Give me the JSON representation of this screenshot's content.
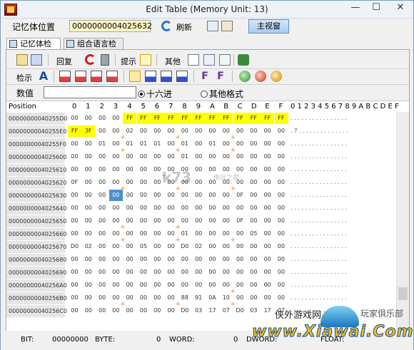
{
  "window": {
    "title": "Edit Table (Memory Unit: 13)",
    "controls": {
      "minimize": "—",
      "maximize": "☐",
      "close": "✕"
    }
  },
  "addressbar": {
    "label": "记忆体位置",
    "address": "0000000004025632",
    "refresh": "刷新",
    "main_view": "主视窗"
  },
  "tabs": [
    {
      "label": "记忆体检示"
    },
    {
      "label": "组合语言检示"
    }
  ],
  "toolbar1": {
    "revert": "回复",
    "hint": "提示",
    "other": "其他"
  },
  "toolbar2": {
    "display": "检示"
  },
  "valuebar": {
    "label": "数值",
    "radio_hex": "十六进",
    "radio_other": "其他格式"
  },
  "grid": {
    "position_header": "Position",
    "hex_headers": [
      "0",
      "1",
      "2",
      "3",
      "4",
      "5",
      "6",
      "7",
      "8",
      "9",
      "A",
      "B",
      "C",
      "D",
      "E",
      "F"
    ],
    "ascii_header": "0 1 2 3 4 5 6 7 8 9 A B C D E F",
    "rows": [
      {
        "addr": "00000000040255D0",
        "cells": [
          "00",
          "00",
          "00",
          "00",
          "FF",
          "FF",
          "FF",
          "FF",
          "FF",
          "FF",
          "FF",
          "FF",
          "FF",
          "FF",
          "FF",
          "FF"
        ],
        "ascii": ". . . . . . . . . . . . . . . ."
      },
      {
        "addr": "00000000040255E0",
        "cells": [
          "FF",
          "3F",
          "00",
          "00",
          "02",
          "00",
          "00",
          "00",
          "00",
          "00",
          "00",
          "00",
          "00",
          "00",
          "00",
          "00"
        ],
        "ascii": ". ? . . . . . . . . . . . . . ."
      },
      {
        "addr": "00000000040255F0",
        "cells": [
          "00",
          "00",
          "01",
          "00",
          "01",
          "01",
          "01",
          "00",
          "01",
          "00",
          "01",
          "00",
          "00",
          "00",
          "00",
          "00"
        ],
        "ascii": ". . . . . . . . . . . . . . . ."
      },
      {
        "addr": "0000000004025600",
        "cells": [
          "00",
          "00",
          "00",
          "00",
          "00",
          "00",
          "00",
          "00",
          "01",
          "00",
          "00",
          "00",
          "00",
          "00",
          "00",
          "00"
        ],
        "ascii": ". . . . . . . . . . . . . . . ."
      },
      {
        "addr": "0000000004025610",
        "cells": [
          "00",
          "00",
          "00",
          "00",
          "00",
          "00",
          "00",
          "00",
          "00",
          "00",
          "00",
          "00",
          "00",
          "00",
          "00",
          "00"
        ],
        "ascii": ". . . . . . . . . . . . . . . ."
      },
      {
        "addr": "0000000004025620",
        "cells": [
          "0F",
          "00",
          "00",
          "00",
          "00",
          "00",
          "00",
          "00",
          "00",
          "00",
          "00",
          "00",
          "00",
          "00",
          "00",
          "00"
        ],
        "ascii": ". . . . . . . . . . . . . . . ."
      },
      {
        "addr": "0000000004025630",
        "cells": [
          "00",
          "00",
          "00",
          "00",
          "00",
          "00",
          "00",
          "00",
          "00",
          "00",
          "00",
          "00",
          "0F",
          "00",
          "00",
          "00"
        ],
        "ascii": ". . . . . . . . . . . . . . . ."
      },
      {
        "addr": "0000000004025640",
        "cells": [
          "00",
          "00",
          "00",
          "00",
          "00",
          "00",
          "00",
          "00",
          "00",
          "00",
          "00",
          "00",
          "00",
          "00",
          "00",
          "00"
        ],
        "ascii": ". . . . . . . . . . . . . . . ."
      },
      {
        "addr": "0000000004025650",
        "cells": [
          "00",
          "00",
          "00",
          "00",
          "00",
          "00",
          "00",
          "00",
          "00",
          "00",
          "00",
          "00",
          "0F",
          "00",
          "00",
          "00"
        ],
        "ascii": ". . . . . . . . . . . . . . . ."
      },
      {
        "addr": "0000000004025660",
        "cells": [
          "00",
          "00",
          "00",
          "00",
          "00",
          "00",
          "00",
          "00",
          "01",
          "00",
          "00",
          "00",
          "00",
          "05",
          "00",
          "00"
        ],
        "ascii": ". . . . . . . . . . . . . . . ."
      },
      {
        "addr": "0000000004025670",
        "cells": [
          "D0",
          "02",
          "00",
          "00",
          "00",
          "05",
          "00",
          "00",
          "D0",
          "02",
          "00",
          "00",
          "00",
          "00",
          "00",
          "00"
        ],
        "ascii": ". . . . . . . . . . . . . . . ."
      },
      {
        "addr": "0000000004025680",
        "cells": [
          "00",
          "00",
          "00",
          "00",
          "00",
          "00",
          "00",
          "00",
          "00",
          "00",
          "00",
          "00",
          "00",
          "00",
          "00",
          "00"
        ],
        "ascii": ". . . . . . . . . . . . . . . ."
      },
      {
        "addr": "0000000004025690",
        "cells": [
          "00",
          "00",
          "00",
          "00",
          "00",
          "00",
          "00",
          "00",
          "00",
          "00",
          "00",
          "00",
          "00",
          "00",
          "00",
          "00"
        ],
        "ascii": ". . . . . . . . . . . . . . . ."
      },
      {
        "addr": "00000000040256A0",
        "cells": [
          "00",
          "00",
          "00",
          "00",
          "00",
          "00",
          "00",
          "00",
          "00",
          "00",
          "00",
          "00",
          "00",
          "00",
          "00",
          "00"
        ],
        "ascii": ". . . . . . . . . . . . . . . ."
      },
      {
        "addr": "00000000040256B0",
        "cells": [
          "00",
          "00",
          "00",
          "00",
          "00",
          "00",
          "00",
          "00",
          "88",
          "91",
          "0A",
          "10",
          "00",
          "00",
          "00",
          "00"
        ],
        "ascii": ". . . . . . . . . . . . . . . ."
      },
      {
        "addr": "00000000040256C0",
        "cells": [
          "00",
          "00",
          "00",
          "00",
          "00",
          "00",
          "00",
          "00",
          "D0",
          "03",
          "17",
          "07",
          "D0",
          "03",
          "17",
          "07"
        ],
        "ascii": ". . . . . . . . . . . . . . . ."
      }
    ]
  },
  "watermark": {
    "k73": "k73",
    "k73_sub": "电玩之家",
    "xiawai_top": "侠外游戏网",
    "xiawai_top2": "玩家俱乐部",
    "xiawai_main": "www.Xiawai.Com"
  },
  "statusbar": {
    "bit_label": "BIT:",
    "bit_value": "00000000",
    "byte_label": "BYTE:",
    "byte_value": "0",
    "word_label": "WORD:",
    "word_value": "0",
    "dword_label": "DWORD:",
    "float_label": "FLOAT:"
  },
  "colors": {
    "highlight": "#ffff00",
    "selected": "#4a90d0",
    "address_col": "#e6e6e6"
  }
}
